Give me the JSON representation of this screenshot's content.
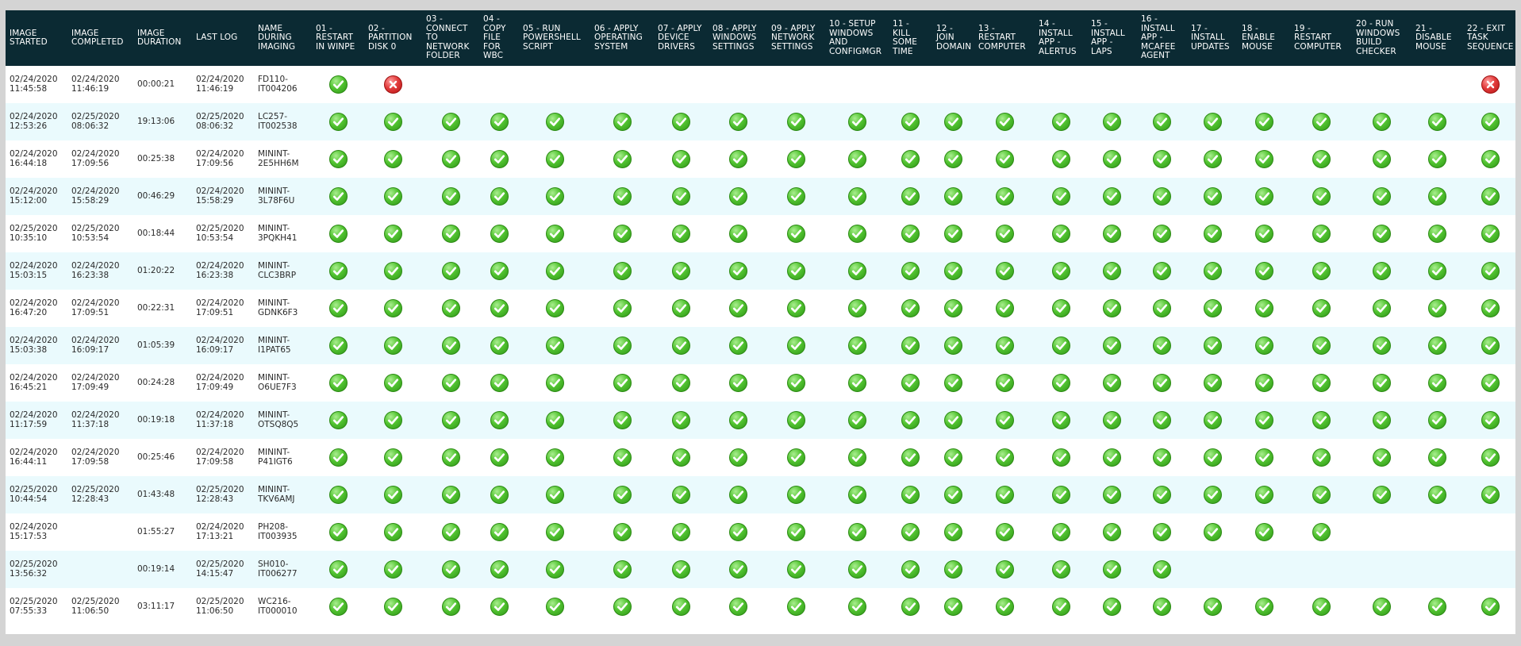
{
  "columns": [
    "IMAGE STARTED",
    "IMAGE COMPLETED",
    "IMAGE DURATION",
    "LAST LOG",
    "NAME DURING IMAGING",
    "01 - RESTART IN WINPE",
    "02 - PARTITION DISK 0",
    "03 - CONNECT TO NETWORK FOLDER",
    "04 - COPY FILE FOR WBC",
    "05 - RUN POWERSHELL SCRIPT",
    "06 - APPLY OPERATING SYSTEM",
    "07 - APPLY DEVICE DRIVERS",
    "08 - APPLY WINDOWS SETTINGS",
    "09 - APPLY NETWORK SETTINGS",
    "10 - SETUP WINDOWS AND CONFIGMGR",
    "11 - KILL SOME TIME",
    "12 - JOIN DOMAIN",
    "13 - RESTART COMPUTER",
    "14 - INSTALL APP - ALERTUS",
    "15 - INSTALL APP - LAPS",
    "16 - INSTALL APP - MCAFEE AGENT",
    "17 - INSTALL UPDATES",
    "18 - ENABLE MOUSE",
    "19 - RESTART COMPUTER",
    "20 - RUN WINDOWS BUILD CHECKER",
    "21 - DISABLE MOUSE",
    "22 - EXIT TASK SEQUENCE"
  ],
  "status_legend": {
    "ok": "green-check-icon",
    "fail": "red-x-icon",
    "ok_color": "#3fae22",
    "fail_color": "#d82b2b",
    "header_bg": "#0b2a33",
    "stripe_bg": "#eafafd"
  },
  "rows": [
    {
      "started": "02/24/2020 11:45:58",
      "completed": "02/24/2020 11:46:19",
      "duration": "00:00:21",
      "last_log": "02/24/2020 11:46:19",
      "name": "FD110-IT004206",
      "steps": [
        "ok",
        "fail",
        "",
        "",
        "",
        "",
        "",
        "",
        "",
        "",
        "",
        "",
        "",
        "",
        "",
        "",
        "",
        "",
        "",
        "",
        "",
        "fail"
      ]
    },
    {
      "started": "02/24/2020 12:53:26",
      "completed": "02/25/2020 08:06:32",
      "duration": "19:13:06",
      "last_log": "02/25/2020 08:06:32",
      "name": "LC257-IT002538",
      "steps": [
        "ok",
        "ok",
        "ok",
        "ok",
        "ok",
        "ok",
        "ok",
        "ok",
        "ok",
        "ok",
        "ok",
        "ok",
        "ok",
        "ok",
        "ok",
        "ok",
        "ok",
        "ok",
        "ok",
        "ok",
        "ok",
        "ok"
      ]
    },
    {
      "started": "02/24/2020 16:44:18",
      "completed": "02/24/2020 17:09:56",
      "duration": "00:25:38",
      "last_log": "02/24/2020 17:09:56",
      "name": "MININT-2E5HH6M",
      "steps": [
        "ok",
        "ok",
        "ok",
        "ok",
        "ok",
        "ok",
        "ok",
        "ok",
        "ok",
        "ok",
        "ok",
        "ok",
        "ok",
        "ok",
        "ok",
        "ok",
        "ok",
        "ok",
        "ok",
        "ok",
        "ok",
        "ok"
      ]
    },
    {
      "started": "02/24/2020 15:12:00",
      "completed": "02/24/2020 15:58:29",
      "duration": "00:46:29",
      "last_log": "02/24/2020 15:58:29",
      "name": "MININT-3L78F6U",
      "steps": [
        "ok",
        "ok",
        "ok",
        "ok",
        "ok",
        "ok",
        "ok",
        "ok",
        "ok",
        "ok",
        "ok",
        "ok",
        "ok",
        "ok",
        "ok",
        "ok",
        "ok",
        "ok",
        "ok",
        "ok",
        "ok",
        "ok"
      ]
    },
    {
      "started": "02/25/2020 10:35:10",
      "completed": "02/25/2020 10:53:54",
      "duration": "00:18:44",
      "last_log": "02/25/2020 10:53:54",
      "name": "MININT-3PQKH41",
      "steps": [
        "ok",
        "ok",
        "ok",
        "ok",
        "ok",
        "ok",
        "ok",
        "ok",
        "ok",
        "ok",
        "ok",
        "ok",
        "ok",
        "ok",
        "ok",
        "ok",
        "ok",
        "ok",
        "ok",
        "ok",
        "ok",
        "ok"
      ]
    },
    {
      "started": "02/24/2020 15:03:15",
      "completed": "02/24/2020 16:23:38",
      "duration": "01:20:22",
      "last_log": "02/24/2020 16:23:38",
      "name": "MININT-CLC3BRP",
      "steps": [
        "ok",
        "ok",
        "ok",
        "ok",
        "ok",
        "ok",
        "ok",
        "ok",
        "ok",
        "ok",
        "ok",
        "ok",
        "ok",
        "ok",
        "ok",
        "ok",
        "ok",
        "ok",
        "ok",
        "ok",
        "ok",
        "ok"
      ]
    },
    {
      "started": "02/24/2020 16:47:20",
      "completed": "02/24/2020 17:09:51",
      "duration": "00:22:31",
      "last_log": "02/24/2020 17:09:51",
      "name": "MININT-GDNK6F3",
      "steps": [
        "ok",
        "ok",
        "ok",
        "ok",
        "ok",
        "ok",
        "ok",
        "ok",
        "ok",
        "ok",
        "ok",
        "ok",
        "ok",
        "ok",
        "ok",
        "ok",
        "ok",
        "ok",
        "ok",
        "ok",
        "ok",
        "ok"
      ]
    },
    {
      "started": "02/24/2020 15:03:38",
      "completed": "02/24/2020 16:09:17",
      "duration": "01:05:39",
      "last_log": "02/24/2020 16:09:17",
      "name": "MININT-I1PAT65",
      "steps": [
        "ok",
        "ok",
        "ok",
        "ok",
        "ok",
        "ok",
        "ok",
        "ok",
        "ok",
        "ok",
        "ok",
        "ok",
        "ok",
        "ok",
        "ok",
        "ok",
        "ok",
        "ok",
        "ok",
        "ok",
        "ok",
        "ok"
      ]
    },
    {
      "started": "02/24/2020 16:45:21",
      "completed": "02/24/2020 17:09:49",
      "duration": "00:24:28",
      "last_log": "02/24/2020 17:09:49",
      "name": "MININT-O6UE7F3",
      "steps": [
        "ok",
        "ok",
        "ok",
        "ok",
        "ok",
        "ok",
        "ok",
        "ok",
        "ok",
        "ok",
        "ok",
        "ok",
        "ok",
        "ok",
        "ok",
        "ok",
        "ok",
        "ok",
        "ok",
        "ok",
        "ok",
        "ok"
      ]
    },
    {
      "started": "02/24/2020 11:17:59",
      "completed": "02/24/2020 11:37:18",
      "duration": "00:19:18",
      "last_log": "02/24/2020 11:37:18",
      "name": "MININT-OTSQ8Q5",
      "steps": [
        "ok",
        "ok",
        "ok",
        "ok",
        "ok",
        "ok",
        "ok",
        "ok",
        "ok",
        "ok",
        "ok",
        "ok",
        "ok",
        "ok",
        "ok",
        "ok",
        "ok",
        "ok",
        "ok",
        "ok",
        "ok",
        "ok"
      ]
    },
    {
      "started": "02/24/2020 16:44:11",
      "completed": "02/24/2020 17:09:58",
      "duration": "00:25:46",
      "last_log": "02/24/2020 17:09:58",
      "name": "MININT-P41IGT6",
      "steps": [
        "ok",
        "ok",
        "ok",
        "ok",
        "ok",
        "ok",
        "ok",
        "ok",
        "ok",
        "ok",
        "ok",
        "ok",
        "ok",
        "ok",
        "ok",
        "ok",
        "ok",
        "ok",
        "ok",
        "ok",
        "ok",
        "ok"
      ]
    },
    {
      "started": "02/25/2020 10:44:54",
      "completed": "02/25/2020 12:28:43",
      "duration": "01:43:48",
      "last_log": "02/25/2020 12:28:43",
      "name": "MININT-TKV6AMJ",
      "steps": [
        "ok",
        "ok",
        "ok",
        "ok",
        "ok",
        "ok",
        "ok",
        "ok",
        "ok",
        "ok",
        "ok",
        "ok",
        "ok",
        "ok",
        "ok",
        "ok",
        "ok",
        "ok",
        "ok",
        "ok",
        "ok",
        "ok"
      ]
    },
    {
      "started": "02/24/2020 15:17:53",
      "completed": "",
      "duration": "01:55:27",
      "last_log": "02/24/2020 17:13:21",
      "name": "PH208-IT003935",
      "steps": [
        "ok",
        "ok",
        "ok",
        "ok",
        "ok",
        "ok",
        "ok",
        "ok",
        "ok",
        "ok",
        "ok",
        "ok",
        "ok",
        "ok",
        "ok",
        "ok",
        "ok",
        "ok",
        "ok",
        "",
        "",
        ""
      ]
    },
    {
      "started": "02/25/2020 13:56:32",
      "completed": "",
      "duration": "00:19:14",
      "last_log": "02/25/2020 14:15:47",
      "name": "SH010-IT006277",
      "steps": [
        "ok",
        "ok",
        "ok",
        "ok",
        "ok",
        "ok",
        "ok",
        "ok",
        "ok",
        "ok",
        "ok",
        "ok",
        "ok",
        "ok",
        "ok",
        "ok",
        "",
        "",
        "",
        "",
        "",
        ""
      ]
    },
    {
      "started": "02/25/2020 07:55:33",
      "completed": "02/25/2020 11:06:50",
      "duration": "03:11:17",
      "last_log": "02/25/2020 11:06:50",
      "name": "WC216-IT000010",
      "steps": [
        "ok",
        "ok",
        "ok",
        "ok",
        "ok",
        "ok",
        "ok",
        "ok",
        "ok",
        "ok",
        "ok",
        "ok",
        "ok",
        "ok",
        "ok",
        "ok",
        "ok",
        "ok",
        "ok",
        "ok",
        "ok",
        "ok"
      ]
    }
  ]
}
